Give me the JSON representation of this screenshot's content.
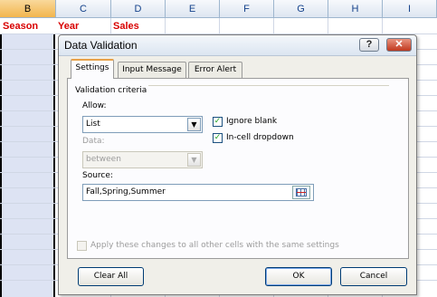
{
  "sheet": {
    "columns": [
      "B",
      "C",
      "D",
      "E",
      "F",
      "G",
      "H",
      "I"
    ],
    "selected_column": "B",
    "header_row": [
      "Season",
      "Year",
      "Sales"
    ],
    "header_color": "#d80000"
  },
  "dialog": {
    "title": "Data Validation",
    "help_glyph": "?",
    "close_glyph": "✕",
    "tabs": [
      {
        "label": "Settings",
        "active": true
      },
      {
        "label": "Input Message",
        "active": false
      },
      {
        "label": "Error Alert",
        "active": false
      }
    ],
    "settings": {
      "section_title": "Validation criteria",
      "allow_label": "Allow:",
      "allow_value": "List",
      "data_label": "Data:",
      "data_value": "between",
      "data_enabled": false,
      "ignore_blank_label": "Ignore blank",
      "ignore_blank_checked": true,
      "in_cell_dropdown_label": "In-cell dropdown",
      "in_cell_dropdown_checked": true,
      "source_label": "Source:",
      "source_value": "Fall,Spring,Summer",
      "apply_all_label": "Apply these changes to all other cells with the same settings",
      "apply_all_checked": false,
      "apply_all_enabled": false
    },
    "buttons": {
      "clear_all": "Clear All",
      "ok": "OK",
      "cancel": "Cancel"
    },
    "colors": {
      "accent_tab": "#e8a24a",
      "check_mark": "#21a121"
    }
  }
}
